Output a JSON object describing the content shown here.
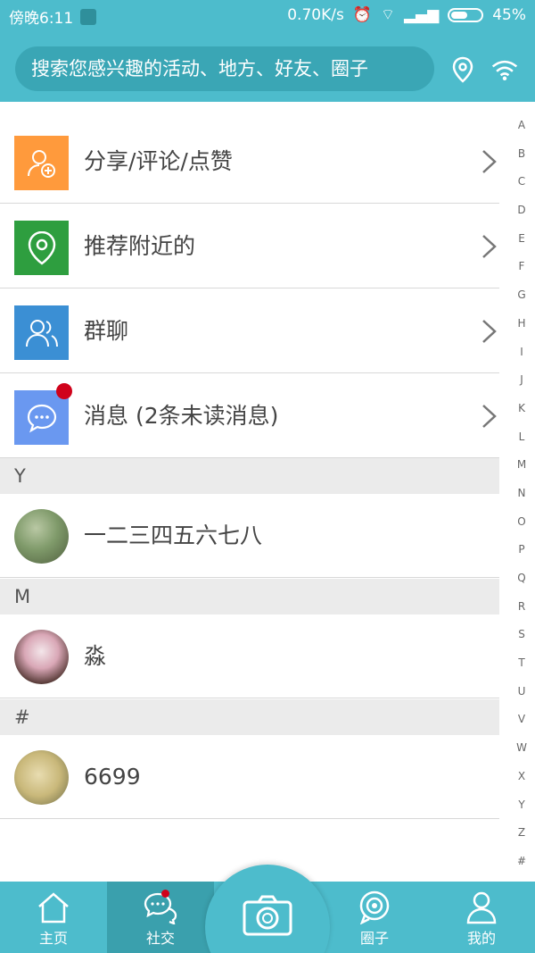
{
  "status_bar": {
    "time": "傍晚6:11",
    "network_speed": "0.70K/s",
    "battery": "45%"
  },
  "header": {
    "search_placeholder": "搜索您感兴趣的活动、地方、好友、圈子"
  },
  "menu": [
    {
      "label": "分享/评论/点赞",
      "icon": "user-add-icon",
      "color": "#ff9a3c"
    },
    {
      "label": "推荐附近的",
      "icon": "location-pin-icon",
      "color": "#2e9e3f"
    },
    {
      "label": "群聊",
      "icon": "group-icon",
      "color": "#3b8fd4"
    },
    {
      "label": "消息 (2条未读消息)",
      "icon": "chat-bubble-icon",
      "color": "#6a98f0",
      "has_unread_dot": true
    }
  ],
  "sections": [
    {
      "letter": "Y",
      "contacts": [
        {
          "name": "一二三四五六七八"
        }
      ]
    },
    {
      "letter": "M",
      "contacts": [
        {
          "name": "淼"
        }
      ]
    },
    {
      "letter": "#",
      "contacts": [
        {
          "name": "6699"
        }
      ]
    }
  ],
  "alphabet": [
    "A",
    "B",
    "C",
    "D",
    "E",
    "F",
    "G",
    "H",
    "I",
    "J",
    "K",
    "L",
    "M",
    "N",
    "O",
    "P",
    "Q",
    "R",
    "S",
    "T",
    "U",
    "V",
    "W",
    "X",
    "Y",
    "Z",
    "#"
  ],
  "tabs": [
    {
      "label": "主页",
      "icon": "home-icon"
    },
    {
      "label": "社交",
      "icon": "social-chat-icon",
      "active": true
    },
    {
      "label": "圈子",
      "icon": "circle-target-icon"
    },
    {
      "label": "我的",
      "icon": "profile-icon"
    }
  ],
  "colors": {
    "primary": "#4dbccc",
    "unread_dot": "#d0021b"
  }
}
